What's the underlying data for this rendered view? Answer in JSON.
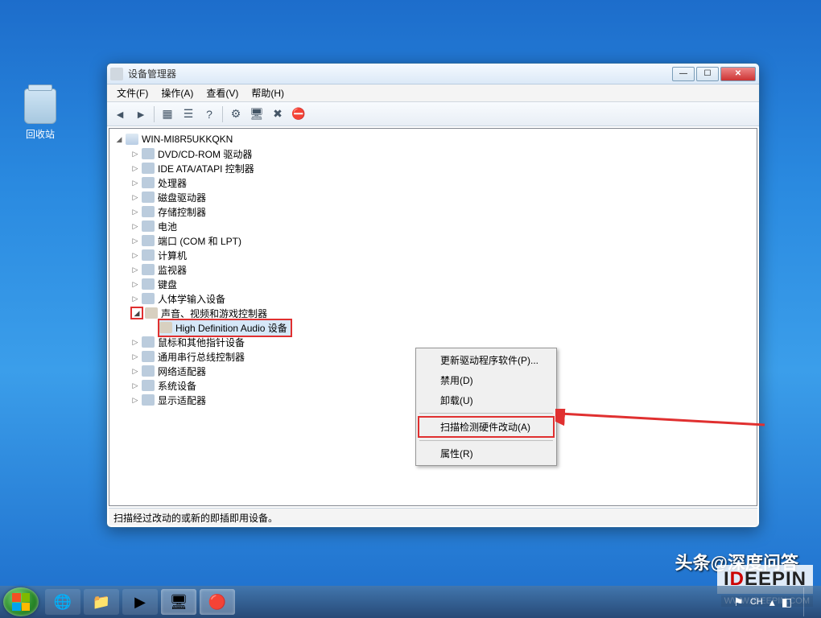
{
  "desktop": {
    "recycle_bin": "回收站"
  },
  "window": {
    "title": "设备管理器",
    "menus": {
      "file": "文件(F)",
      "action": "操作(A)",
      "view": "查看(V)",
      "help": "帮助(H)"
    },
    "root_label": "WIN-MI8R5UKKQKN",
    "nodes": {
      "dvd": "DVD/CD-ROM 驱动器",
      "ide": "IDE ATA/ATAPI 控制器",
      "cpu": "处理器",
      "disk": "磁盘驱动器",
      "storage": "存储控制器",
      "battery": "电池",
      "port": "端口 (COM 和 LPT)",
      "computer": "计算机",
      "monitor": "监视器",
      "keyboard": "键盘",
      "hid": "人体学输入设备",
      "sound": "声音、视频和游戏控制器",
      "hda": "High Definition Audio 设备",
      "mouse": "鼠标和其他指针设备",
      "usb": "通用串行总线控制器",
      "netadapter": "网络适配器",
      "system": "系统设备",
      "display": "显示适配器"
    },
    "status": "扫描经过改动的或新的即插即用设备。"
  },
  "context_menu": {
    "update": "更新驱动程序软件(P)...",
    "disable": "禁用(D)",
    "uninstall": "卸载(U)",
    "scan": "扫描检测硬件改动(A)",
    "properties": "属性(R)"
  },
  "tray": {
    "lang": "CH"
  },
  "watermark": {
    "top": "头条@深度问答",
    "logo_pre": "I",
    "logo_red": "D",
    "logo_post": "EEPIN",
    "url": "WWW.IDEEPIN.COM"
  }
}
